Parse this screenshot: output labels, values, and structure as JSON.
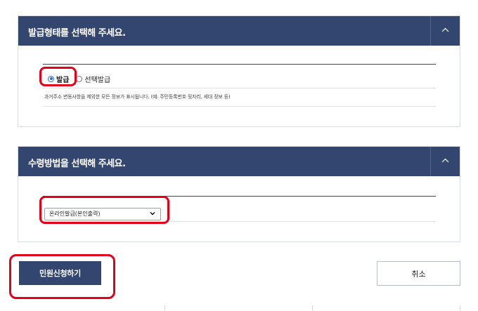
{
  "issue_type_section": {
    "title": "발급형태를 선택해 주세요.",
    "options": [
      {
        "label": "발급",
        "selected": true
      },
      {
        "label": "선택발급",
        "selected": false
      }
    ],
    "description": "과거주소 변동사항을 제외한 모든 정보가 표시됩니다. (예: 주민등록번호 뒷자리, 세대 정보 등)"
  },
  "receive_method_section": {
    "title": "수령방법을 선택해 주세요.",
    "selected_option": "온라인발급(본인출력)"
  },
  "actions": {
    "submit_label": "민원신청하기",
    "cancel_label": "취소"
  },
  "colors": {
    "header_bg": "#33466f",
    "highlight": "#e3001b",
    "radio_accent": "#2a6bd1"
  }
}
